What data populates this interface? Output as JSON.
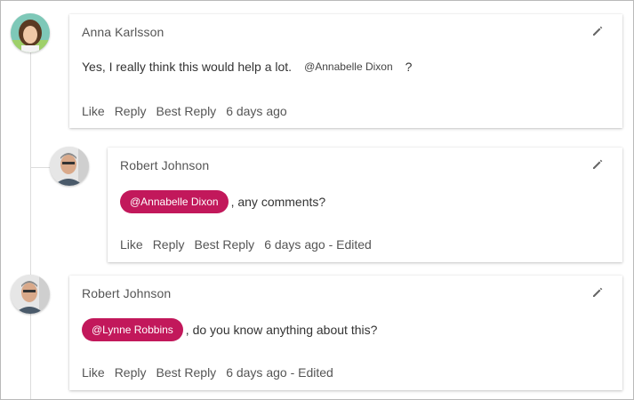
{
  "comments": [
    {
      "author": "Anna Karlsson",
      "text_before": "Yes, I really think this would help a lot.",
      "mention": "@Annabelle Dixon",
      "text_after": "?",
      "actions": [
        "Like",
        "Reply",
        "Best Reply"
      ],
      "time": "6 days ago"
    },
    {
      "author": "Robert Johnson",
      "mention": "@Annabelle Dixon",
      "text_after": ", any comments?",
      "actions": [
        "Like",
        "Reply",
        "Best Reply"
      ],
      "time": "6 days ago - Edited"
    },
    {
      "author": "Robert Johnson",
      "mention": "@Lynne Robbins",
      "text_after": ", do you know anything about this?",
      "actions": [
        "Like",
        "Reply",
        "Best Reply"
      ],
      "time": "6 days ago - Edited"
    }
  ],
  "colors": {
    "mention_chip": "#c2185b",
    "thread_line": "#dcdcdc"
  },
  "icons": [
    "pencil-icon",
    "avatar"
  ]
}
